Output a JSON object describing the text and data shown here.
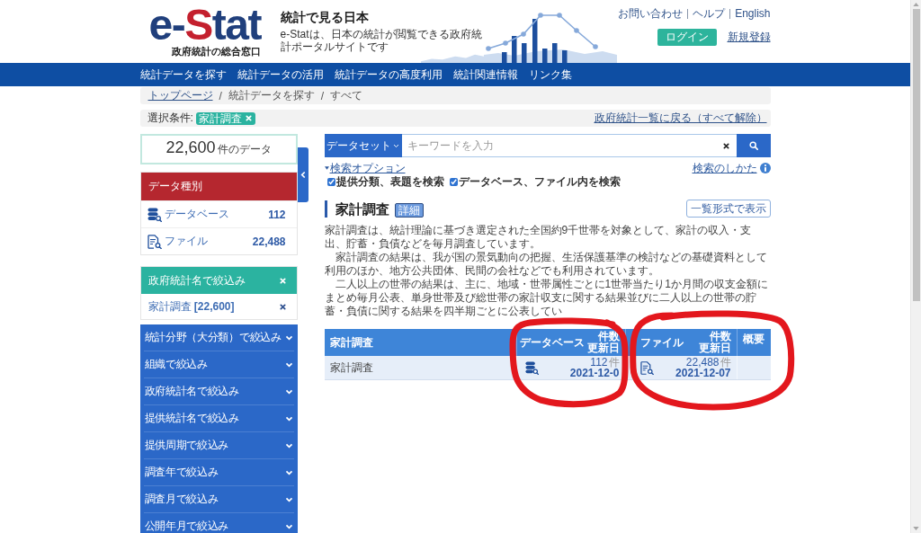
{
  "header": {
    "logo": {
      "parts": [
        {
          "text": "e-",
          "color": "#203f7c"
        },
        {
          "text": "S",
          "color": "#c4202e"
        },
        {
          "text": "tat",
          "color": "#203f7c"
        }
      ],
      "tagline": "政府統計の総合窓口"
    },
    "title": "統計で見る日本",
    "subtitle": "e-Statは、日本の統計が閲覧できる政府統計ポータルサイトです",
    "links": [
      "お問い合わせ",
      "ヘルプ",
      "English"
    ],
    "login_button": "ログイン",
    "register_link": "新規登録"
  },
  "nav": [
    "統計データを探す",
    "統計データの活用",
    "統計データの高度利用",
    "統計関連情報",
    "リンク集"
  ],
  "breadcrumb": [
    {
      "kind": "link",
      "text": "トップページ"
    },
    {
      "kind": "separator",
      "text": "/"
    },
    {
      "kind": "text",
      "text": "統計データを探す"
    },
    {
      "kind": "separator",
      "text": "/"
    },
    {
      "kind": "text",
      "text": "すべて"
    }
  ],
  "filter_bar": {
    "label": "選択条件:",
    "tags": [
      "家計調査"
    ],
    "reset_link": "政府統計一覧に戻る（すべて解除）"
  },
  "sidebar": {
    "result_count": {
      "number": "22,600",
      "unit": "件のデータ"
    },
    "data_type": {
      "title": "データ種別",
      "items": [
        {
          "kind": "database",
          "label": "データベース",
          "count": "112"
        },
        {
          "kind": "file",
          "label": "ファイル",
          "count": "22,488"
        }
      ]
    },
    "active_filter": {
      "title": "政府統計名で絞込み",
      "items": [
        "家計調査 **[22,600]**"
      ]
    },
    "filter_groups": [
      {
        "label": "統計分野（大分類）で絞込み",
        "expanded": false
      },
      {
        "label": "組織で絞込み",
        "expanded": false
      },
      {
        "label": "政府統計名で絞込み",
        "expanded": false
      },
      {
        "label": "提供統計名で絞込み",
        "expanded": false
      },
      {
        "label": "提供周期で絞込み",
        "expanded": false
      },
      {
        "label": "調査年で絞込み",
        "expanded": false
      },
      {
        "label": "調査月で絞込み",
        "expanded": false
      },
      {
        "label": "公開年月で絞込み",
        "expanded": false
      }
    ]
  },
  "search": {
    "scope": "データセット",
    "placeholder": "キーワードを入力",
    "options_link": {
      "label": "検索オプション",
      "expanded": true
    },
    "help_link": "検索のしかた",
    "checkboxes": [
      {
        "label": "提供分類、表題を検索",
        "checked": true
      },
      {
        "label": "データベース、ファイル内を検索",
        "checked": true
      }
    ]
  },
  "survey": {
    "title": "家計調査",
    "detail_button": "詳細",
    "list_view_button": "一覧形式で表示",
    "paragraphs": [
      "家計調査は、統計理論に基づき選定された全国約9千世帯を対象として、家計の収入・支出、貯蓄・負債などを毎月調査しています。",
      "家計調査の結果は、我が国の景気動向の把握、生活保護基準の検討などの基礎資料として利用のほか、地方公共団体、民間の会社などでも利用されています。",
      "二人以上の世帯の結果は、主に、地域・世帯属性ごとに1世帯当たり1か月間の収支金額にまとめ毎月公表、単身世帯及び総世帯の家計収支に関する結果並びに二人以上の世帯の貯蓄・負債に関する結果を四半期ごとに公表してい"
    ]
  },
  "table": {
    "columns": [
      {
        "kind": "name",
        "label": "家計調査"
      },
      {
        "kind": "database",
        "label": "データベース",
        "sub_labels": [
          "件数",
          "更新日"
        ]
      },
      {
        "kind": "file",
        "label": "ファイル",
        "sub_labels": [
          "件数",
          "更新日"
        ]
      },
      {
        "kind": "summary",
        "label": "概要"
      }
    ],
    "rows": [
      {
        "name": "家計調査",
        "database": {
          "count": "112",
          "unit": "件",
          "date": "2021-12-0"
        },
        "file": {
          "count": "22,488",
          "unit": "件",
          "date": "2021-12-07"
        }
      }
    ]
  }
}
